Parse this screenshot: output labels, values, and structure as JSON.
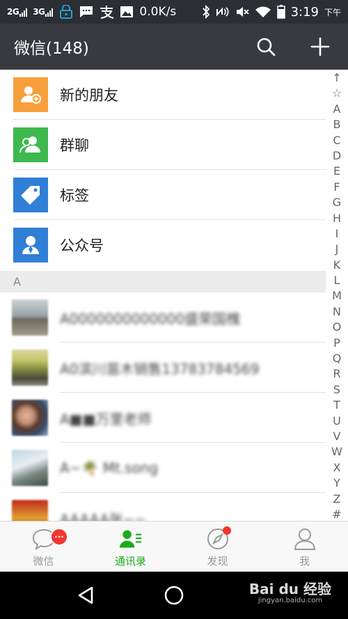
{
  "status_bar": {
    "signal_1": "2G",
    "signal_2": "3G",
    "network_speed": "0.0K/s",
    "time": "3:19",
    "ampm": "下午",
    "icons": [
      "sim-signal-icon",
      "sim-signal-icon",
      "vpn-lock-icon",
      "message-icon",
      "alipay-icon",
      "image-icon",
      "bluetooth-icon",
      "nfc-icon",
      "mute-icon",
      "wifi-icon",
      "battery-icon"
    ]
  },
  "navbar": {
    "title": "微信(148)",
    "actions": [
      "search-icon",
      "plus-icon"
    ]
  },
  "functions": [
    {
      "label": "新的朋友",
      "icon": "add-friend-icon",
      "color": "#f7a03b"
    },
    {
      "label": "群聊",
      "icon": "group-chat-icon",
      "color": "#3db94e"
    },
    {
      "label": "标签",
      "icon": "tag-icon",
      "color": "#2f7fd6"
    },
    {
      "label": "公众号",
      "icon": "official-account-icon",
      "color": "#2f7fd6"
    }
  ],
  "section": {
    "letter": "A"
  },
  "contacts": [
    {
      "name": "A0000000000000盛荣国槐"
    },
    {
      "name": "A0滨川苗木销售13783784569"
    },
    {
      "name": "A■■万里老师"
    },
    {
      "name": "A~🌴 Mt.song"
    },
    {
      "name": "AAAAA张~~"
    }
  ],
  "index": [
    "↑",
    "☆",
    "A",
    "B",
    "C",
    "D",
    "E",
    "F",
    "G",
    "H",
    "I",
    "J",
    "K",
    "L",
    "M",
    "N",
    "O",
    "P",
    "Q",
    "R",
    "S",
    "T",
    "U",
    "V",
    "W",
    "X",
    "Y",
    "Z",
    "#"
  ],
  "tabs": [
    {
      "label": "微信",
      "icon": "chat-bubble-icon",
      "badge": "···"
    },
    {
      "label": "通讯录",
      "icon": "contacts-icon",
      "active": true
    },
    {
      "label": "发现",
      "icon": "compass-icon",
      "dot": true
    },
    {
      "label": "我",
      "icon": "profile-icon"
    }
  ],
  "watermark": {
    "main": "Bai du 经验",
    "sub": "jingyan.baidu.com"
  },
  "colors": {
    "accent": "#1aad19",
    "nav_bg": "#393a3f",
    "badge": "#f43530"
  }
}
